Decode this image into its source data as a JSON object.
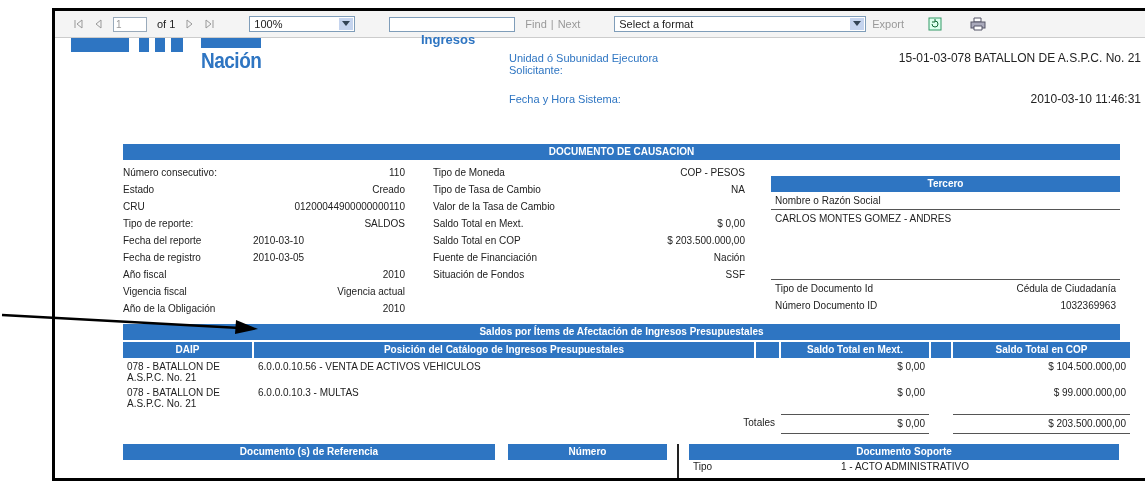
{
  "toolbar": {
    "nav": [
      {
        "kind": "first",
        "disabled": true
      },
      {
        "kind": "prev",
        "disabled": true
      }
    ],
    "page_value": "1",
    "page_count": "of 1",
    "nav_after": [
      {
        "kind": "next",
        "disabled": true
      },
      {
        "kind": "last",
        "disabled": true
      }
    ],
    "zoom": "100%",
    "find_links": [
      {
        "label": "Find",
        "disabled": true
      },
      {
        "label": "Next",
        "disabled": true
      }
    ],
    "find_separator": "|",
    "format": "Select a format",
    "export": {
      "label": "Export",
      "disabled": true
    }
  },
  "header": {
    "title": "Ingresos",
    "logo_text": "Nación",
    "fields": [
      {
        "label": "Unidad ó Subunidad Ejecutora Solicitante:",
        "value": "15-01-03-078 BATALLON DE A.S.P.C. No. 21"
      },
      {
        "label": "Fecha y Hora Sistema:",
        "value": "2010-03-10 11:46:31"
      }
    ]
  },
  "documento": {
    "title": "DOCUMENTO DE CAUSACION",
    "left_fields": [
      {
        "label": "Número consecutivo:",
        "value": "110",
        "kind": "text"
      },
      {
        "label": "Estado",
        "value": "Creado",
        "kind": "text"
      },
      {
        "label": "CRU",
        "value": "01200044900000000110",
        "kind": "text"
      },
      {
        "label": "Tipo de reporte:",
        "value": "SALDOS",
        "kind": "text"
      },
      {
        "label": "Fecha del reporte",
        "value": "2010-03-10",
        "kind": "date"
      },
      {
        "label": "Fecha de registro",
        "value": "2010-03-05",
        "kind": "date"
      },
      {
        "label": "Año fiscal",
        "value": "2010",
        "kind": "text"
      },
      {
        "label": "Vigencia fiscal",
        "value": "Vigencia actual",
        "kind": "text"
      },
      {
        "label": "Año de la Obligación",
        "value": "2010",
        "kind": "text"
      }
    ],
    "middle_fields": [
      {
        "label": "Tipo de Moneda",
        "value": "COP - PESOS"
      },
      {
        "label": "Tipo de Tasa de Cambio",
        "value": "NA"
      },
      {
        "label": "Valor de la Tasa de Cambio"
      },
      {
        "label": "Saldo Total en Mext.",
        "value": "$ 0,00"
      },
      {
        "label": "Saldo Total en COP",
        "value": "$ 203.500.000,00"
      },
      {
        "label": "Fuente de Financiación",
        "value": "Nación"
      },
      {
        "label": "Situación de Fondos",
        "value": "SSF"
      }
    ],
    "tercero": {
      "title": "Tercero",
      "name_label": "Nombre o Razón Social",
      "name_value": "CARLOS MONTES GOMEZ - ANDRES",
      "fields": [
        {
          "label": "Tipo de Documento Id",
          "value": "Cédula de Ciudadanía"
        },
        {
          "label": "Número Documento ID",
          "value": "1032369963"
        }
      ]
    }
  },
  "saldos": {
    "title": "Saldos por Ítems de Afectación de Ingresos Presupuestales",
    "columns": [
      "DAIP",
      "Posición del Catálogo de Ingresos Presupuestales",
      "Saldo Total en Mext.",
      "Saldo Total en COP"
    ],
    "rows": [
      {
        "daip": "078 - BATALLON DE A.S.P.C. No. 21",
        "posicion": "6.0.0.0.10.56 - VENTA DE ACTIVOS VEHICULOS",
        "mext": "$ 0,00",
        "cop": "$ 104.500.000,00"
      },
      {
        "daip": "078 - BATALLON DE A.S.P.C. No. 21",
        "posicion": "6.0.0.0.10.3 - MULTAS",
        "mext": "$ 0,00",
        "cop": "$ 99.000.000,00"
      }
    ],
    "totals": {
      "label": "Totales",
      "mext": "$ 0,00",
      "cop": "$ 203.500.000,00"
    }
  },
  "referencia": {
    "headers": [
      "Documento (s) de Referencia",
      "Número"
    ],
    "soporte": {
      "title": "Documento Soporte",
      "label": "Tipo",
      "value": "1 - ACTO ADMINISTRATIVO"
    }
  }
}
